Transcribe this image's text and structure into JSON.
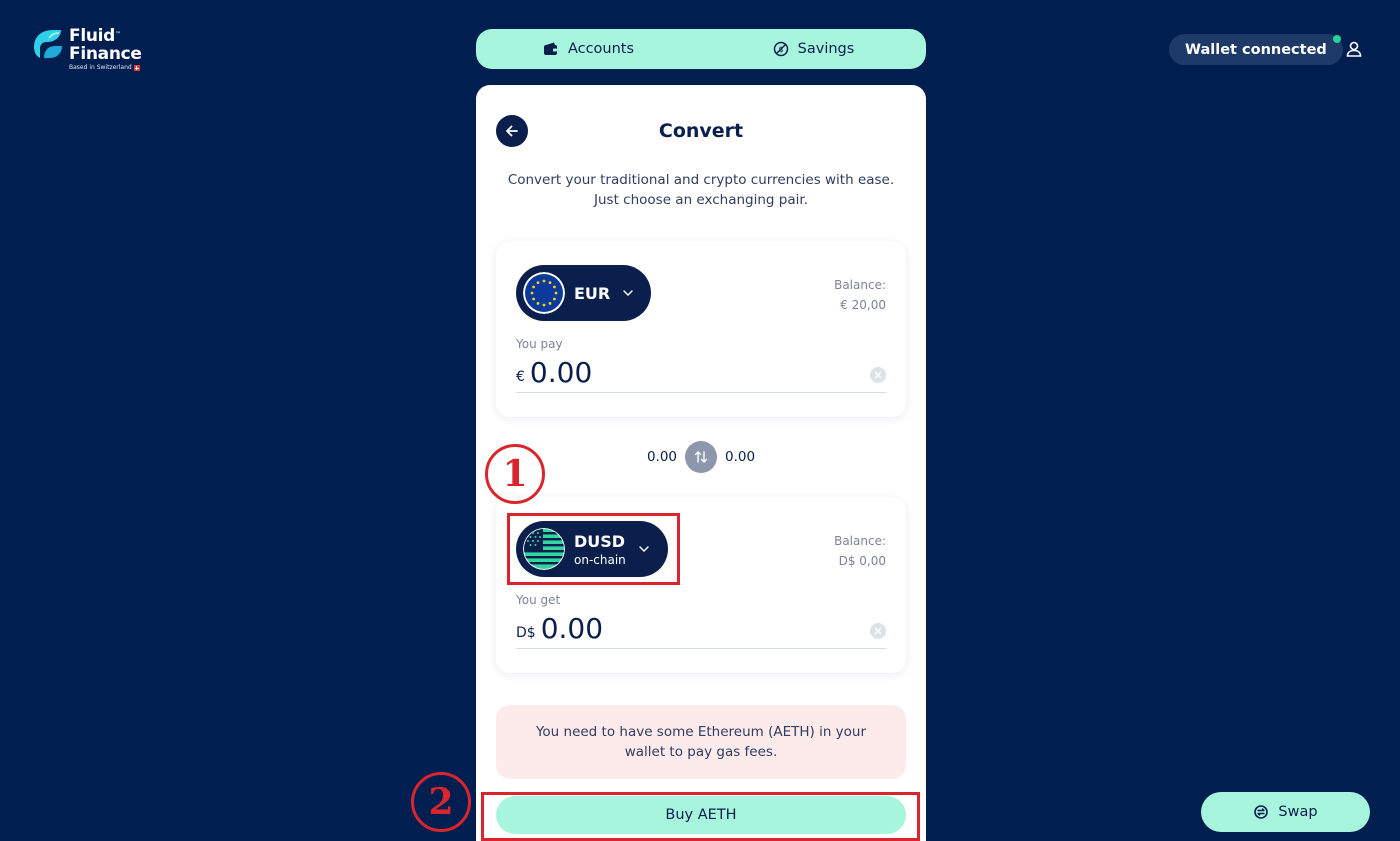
{
  "brand": {
    "line1": "Fluid",
    "tm": "™",
    "line2": "Finance",
    "tagline": "Based in Switzerland"
  },
  "nav": {
    "tabs": [
      {
        "label": "Accounts",
        "icon": "wallet-icon"
      },
      {
        "label": "Savings",
        "icon": "savings-icon"
      }
    ]
  },
  "header": {
    "wallet_label": "Wallet connected",
    "wallet_status_color": "#25d39a"
  },
  "convert": {
    "title": "Convert",
    "subtitle_line1": "Convert your traditional and crypto currencies with ease.",
    "subtitle_line2": "Just choose an exchanging pair.",
    "pay": {
      "currency": "EUR",
      "balance_label": "Balance:",
      "balance_value": "€ 20,00",
      "amount_label": "You pay",
      "symbol": "€",
      "amount": "0.00"
    },
    "rate_from": "0.00",
    "rate_to": "0.00",
    "get": {
      "currency": "DUSD",
      "currency_sub": "on-chain",
      "balance_label": "Balance:",
      "balance_value": "D$ 0,00",
      "amount_label": "You get",
      "symbol": "D$",
      "amount": "0.00"
    },
    "warning_line1": "You need to have some Ethereum (AETH) in your",
    "warning_line2": "wallet to pay gas fees.",
    "buy_label": "Buy AETH"
  },
  "fab": {
    "swap_label": "Swap"
  },
  "annotations": {
    "marker1": "1",
    "marker2": "2"
  },
  "colors": {
    "background": "#011e50",
    "accent": "#a8f5dd",
    "dark": "#0b1f4d",
    "warning_bg": "#fdeaea",
    "annotation": "#d9262e"
  }
}
